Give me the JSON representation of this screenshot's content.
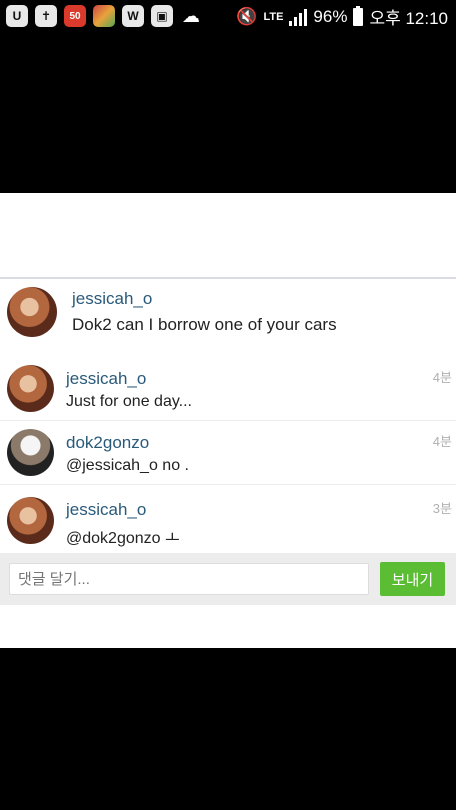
{
  "status_bar": {
    "battery": "96%",
    "time": "오후 12:10",
    "network": "LTE",
    "notif_badge": "50"
  },
  "post": {
    "username": "jessicah_o",
    "caption": "Dok2 can I borrow one of your cars"
  },
  "comments": [
    {
      "username": "jessicah_o",
      "text": "Just for one day...",
      "time": "4분"
    },
    {
      "username": "dok2gonzo",
      "text": "@jessicah_o no .",
      "time": "4분"
    },
    {
      "username": "jessicah_o",
      "text": "@dok2gonzo ㅗ",
      "time": "3분"
    }
  ],
  "composer": {
    "placeholder": "댓글 달기...",
    "send_label": "보내기"
  }
}
